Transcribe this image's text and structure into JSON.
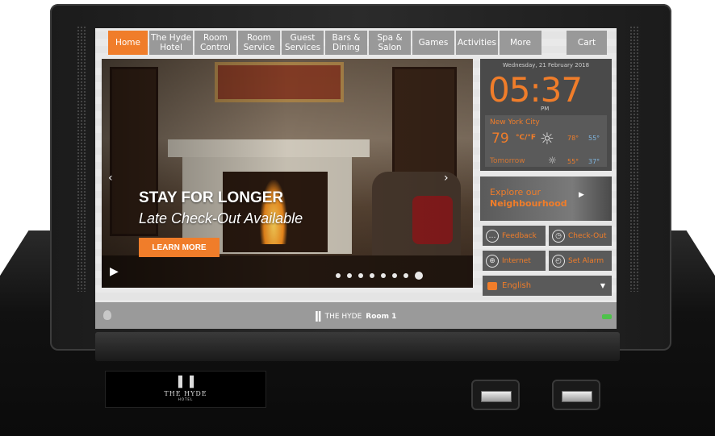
{
  "nav": {
    "tabs": [
      {
        "label": "Home",
        "active": true
      },
      {
        "label": "The Hyde Hotel",
        "active": false
      },
      {
        "label": "Room Control",
        "active": false
      },
      {
        "label": "Room Service",
        "active": false
      },
      {
        "label": "Guest Services",
        "active": false
      },
      {
        "label": "Bars & Dining",
        "active": false
      },
      {
        "label": "Spa & Salon",
        "active": false
      },
      {
        "label": "Games",
        "active": false
      },
      {
        "label": "Activities",
        "active": false
      },
      {
        "label": "More",
        "active": false
      }
    ],
    "cart_label": "Cart"
  },
  "hero": {
    "headline": "STAY FOR LONGER",
    "subheadline": "Late Check-Out Available",
    "cta_label": "LEARN MORE",
    "prev_icon": "‹",
    "next_icon": "›",
    "play_icon": "▶",
    "slide_count": 8,
    "active_slide": 8
  },
  "clock": {
    "date": "Wednesday, 21 February 2018",
    "time": "05:37",
    "meridiem": "PM"
  },
  "weather": {
    "city": "New York City",
    "current_temp": "79",
    "units": "°C/°F",
    "today_high": "78°",
    "today_low": "55°",
    "tomorrow_label": "Tomorrow",
    "tomorrow_high": "55°",
    "tomorrow_low": "37°",
    "icon": "sun-icon"
  },
  "explore": {
    "line1": "Explore our",
    "line2": "Neighbourhood"
  },
  "services": {
    "feedback": "Feedback",
    "checkout": "Check-Out",
    "internet": "Internet",
    "alarm": "Set Alarm"
  },
  "language": {
    "selected": "English"
  },
  "status": {
    "brand": "THE HYDE",
    "room": "Room 1"
  },
  "device": {
    "plate_name": "THE HYDE",
    "plate_sub": "HOTEL"
  },
  "colors": {
    "accent": "#f07d2a",
    "tab": "#999999",
    "tile": "#5a5a5a",
    "cold": "#7fb6e0"
  }
}
